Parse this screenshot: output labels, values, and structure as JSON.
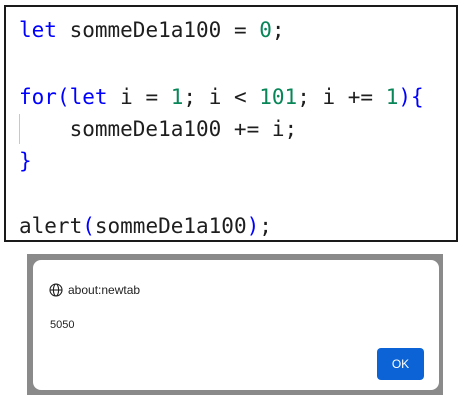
{
  "code": {
    "line1": {
      "kw": "let",
      "text1": " sommeDe1a100 = ",
      "num": "0",
      "text2": ";"
    },
    "line2": {
      "kw_for": "for",
      "paren_open": "(",
      "kw_let": "let",
      "text1": " i = ",
      "num1": "1",
      "text2": "; i < ",
      "num2": "101",
      "text3": "; i += ",
      "num3": "1",
      "close": "){"
    },
    "line3": {
      "text": "    sommeDe1a100 += i;"
    },
    "line4": {
      "brace": "}"
    },
    "line5": {
      "fn": "alert",
      "paren_open": "(",
      "arg": "sommeDe1a100",
      "paren_close": ")",
      "semi": ";"
    }
  },
  "dialog": {
    "title": "about:newtab",
    "message": "5050",
    "ok_label": "OK",
    "icon": "globe-icon"
  },
  "colors": {
    "keyword": "#0000ff",
    "number": "#098658",
    "button": "#0b63d6"
  }
}
